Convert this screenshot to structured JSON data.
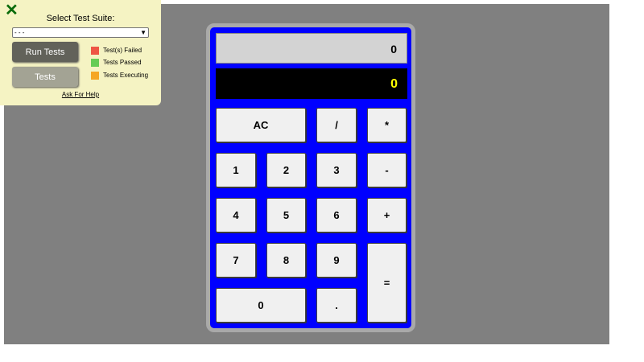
{
  "test_panel": {
    "close_icon": "close-x-icon",
    "title": "Select Test Suite:",
    "suite_select": {
      "selected": "- - -"
    },
    "run_tests_label": "Run Tests",
    "tests_label": "Tests",
    "legend": [
      {
        "label": "Test(s) Failed",
        "color": "#ee5544"
      },
      {
        "label": "Tests Passed",
        "color": "#66cc55"
      },
      {
        "label": "Tests Executing",
        "color": "#f5a623"
      }
    ],
    "help_link": "Ask For Help"
  },
  "calculator": {
    "history_display": "0",
    "result_display": "0",
    "colors": {
      "body": "#0000ff",
      "frame": "#a9a9a9",
      "result_text": "#ffff00"
    },
    "keys": {
      "ac": "AC",
      "divide": "/",
      "multiply": "*",
      "one": "1",
      "two": "2",
      "three": "3",
      "minus": "-",
      "four": "4",
      "five": "5",
      "six": "6",
      "plus": "+",
      "seven": "7",
      "eight": "8",
      "nine": "9",
      "equals": "=",
      "zero": "0",
      "decimal": "."
    }
  }
}
